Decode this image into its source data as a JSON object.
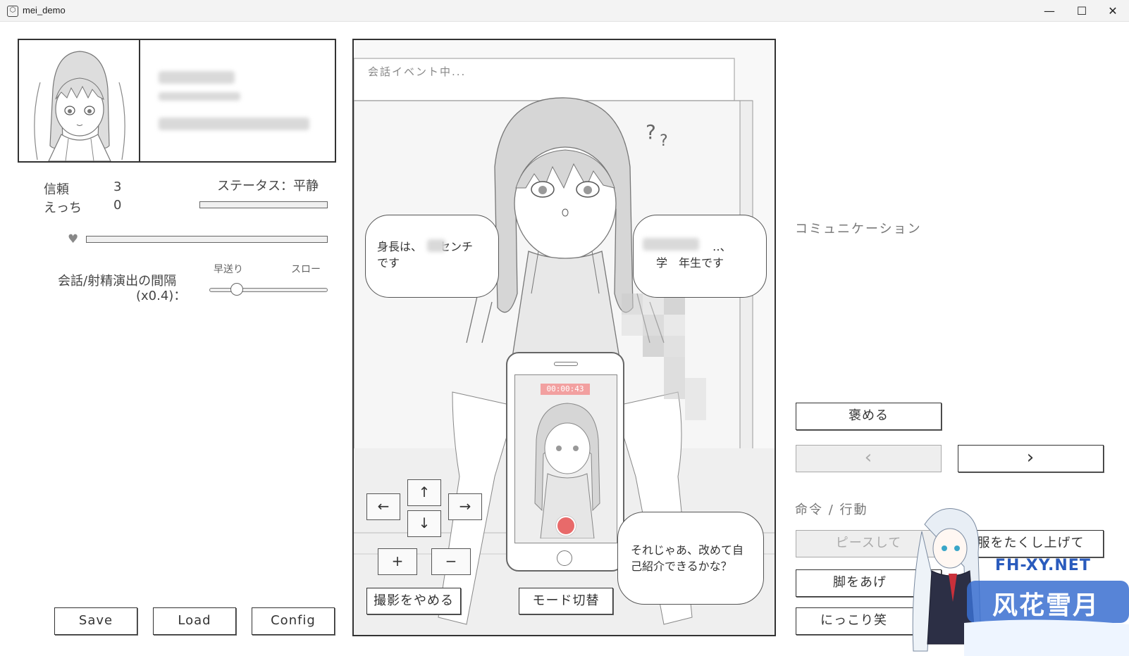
{
  "window": {
    "title": "mei_demo",
    "minimize_glyph": "—",
    "maximize_glyph": "☐",
    "close_glyph": "✕"
  },
  "stats": {
    "trust_label": "信頼",
    "trust_value": "3",
    "ecchi_label": "えっち",
    "ecchi_value": "0",
    "status_label": "ステータス：平静"
  },
  "interval": {
    "label_line1": "会話/射精演出の間隔",
    "label_line2": "(x0.4)：",
    "fast_label": "早送り",
    "slow_label": "スロー",
    "slider_value": 0.2
  },
  "bottom_buttons": {
    "save": "Save",
    "load": "Load",
    "config": "Config"
  },
  "scene": {
    "event_label": "会話イベント中...",
    "question_marks": "??",
    "bubble_left_line1": "身長は、　　センチ",
    "bubble_left_line2": "です",
    "bubble_right_line1": "　　　　　‥、",
    "bubble_right_line2": "学　年生です",
    "bubble_bottom_line1": "それじゃあ、改めて自",
    "bubble_bottom_line2": "己紹介できるかな？",
    "timer": "00:00:43",
    "dpad": {
      "up": "↑",
      "down": "↓",
      "left": "←",
      "right": "→",
      "plus": "+",
      "minus": "−"
    },
    "stop_shooting_button": "撮影をやめる",
    "mode_switch_button": "モード切替"
  },
  "communication": {
    "title": "コミュニケーション",
    "praise_button": "褒める",
    "prev_glyph": "‹",
    "next_glyph": "›"
  },
  "commands": {
    "title": "命令 / 行動",
    "peace_button": "ピースして",
    "lift_clothes_button": "服をたくし上げて",
    "legs_button": "脚をあげ",
    "smile_button": "にっこり笑"
  },
  "watermark": {
    "site": "FH-XY.NET",
    "brand": "风花雪月"
  },
  "colors": {
    "record": "#e86a6a",
    "timer_bg": "#f2a0a0",
    "watermark_blue": "#3a6fd0"
  }
}
